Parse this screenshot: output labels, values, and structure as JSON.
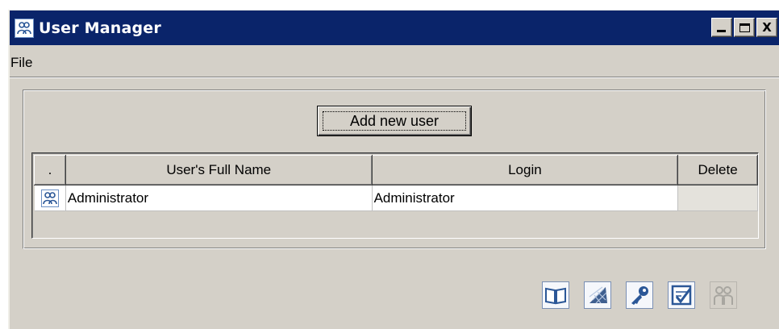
{
  "window": {
    "title": "User Manager",
    "icon": "users-icon",
    "controls": [
      "minimize-icon",
      "maximize-icon",
      "close-icon"
    ],
    "close_glyph": "X"
  },
  "menu": {
    "items": [
      {
        "label": "File"
      }
    ]
  },
  "actions": {
    "add_user_label": "Add new user"
  },
  "table": {
    "columns": [
      ".",
      "User's Full Name",
      "Login",
      "Delete"
    ],
    "rows": [
      {
        "icon": "user-icon",
        "full_name": "Administrator",
        "login": "Administrator",
        "delete": ""
      }
    ]
  },
  "toolbar": {
    "tools": [
      {
        "icon": "book-icon",
        "enabled": true
      },
      {
        "icon": "globe-icon",
        "enabled": true
      },
      {
        "icon": "key-icon",
        "enabled": true
      },
      {
        "icon": "checklist-icon",
        "enabled": true
      },
      {
        "icon": "users-icon",
        "enabled": false
      }
    ]
  },
  "colors": {
    "titlebar": "#0a246a",
    "window_bg": "#d4d0c8",
    "icon_blue": "#2b5797"
  }
}
